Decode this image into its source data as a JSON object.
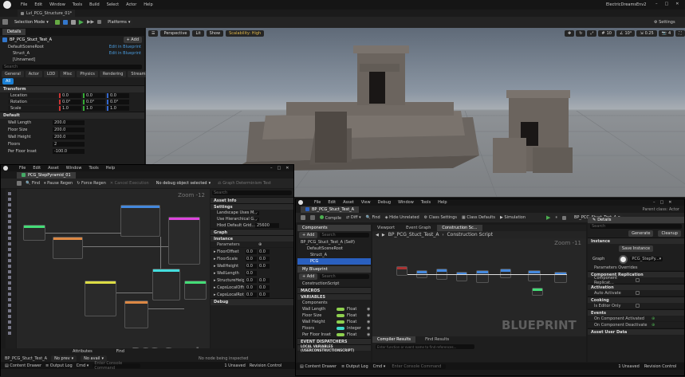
{
  "main": {
    "menu": [
      "File",
      "Edit",
      "Window",
      "Tools",
      "Build",
      "Select",
      "Actor",
      "Help"
    ],
    "window_title": "ElectricDreamsEnv2",
    "level_tab": "Lvl_PCG_Structure_01*",
    "selection_mode": "Selection Mode",
    "platforms": "Platforms",
    "settings": "Settings"
  },
  "details": {
    "tab": "Details",
    "actor_name": "BP_PCG_Stuct_Test_A",
    "add": "+ Add",
    "components": [
      {
        "name": "DefaultSceneRoot",
        "link": "Edit in Blueprint"
      },
      {
        "name": "Struct_A",
        "link": "Edit in Blueprint"
      },
      {
        "name": "[Unnamed]",
        "link": ""
      }
    ],
    "search_placeholder": "Search",
    "filter_tabs": [
      "General",
      "Actor",
      "LOD",
      "Misc",
      "Physics",
      "Rendering",
      "Streaming"
    ],
    "filter_all": "All",
    "transform_header": "Transform",
    "transform": [
      {
        "label": "Location",
        "x": "0.0",
        "y": "0.0",
        "z": "0.0"
      },
      {
        "label": "Rotation",
        "x": "0.0°",
        "y": "0.0°",
        "z": "0.0°"
      },
      {
        "label": "Scale",
        "x": "1.0",
        "y": "1.0",
        "z": "1.0"
      }
    ],
    "default_header": "Default",
    "default_props": [
      {
        "label": "Wall Length",
        "value": "200.0"
      },
      {
        "label": "Floor Size",
        "value": "200.0"
      },
      {
        "label": "Wall Height",
        "value": "200.0"
      },
      {
        "label": "Floors",
        "value": "2"
      },
      {
        "label": "Per Floor Inset",
        "value": "-100.0"
      }
    ]
  },
  "viewport": {
    "perspective": "Perspective",
    "lit": "Lit",
    "show": "Show",
    "scalability": "Scalability: High",
    "grid_value": "10",
    "rot_value": "10°",
    "scale_value": "0.25",
    "cam_value": "4"
  },
  "pcg": {
    "menu": [
      "File",
      "Edit",
      "Asset",
      "Window",
      "Tools",
      "Help"
    ],
    "tab": "PCG_StepPyramid_01",
    "toolbar": {
      "find": "Find",
      "pause": "Pause Regen",
      "force": "Force Regen",
      "cancel": "Cancel Execution",
      "debug": "No debug object selected",
      "determinism": "Graph Determinism Test"
    },
    "zoom": "Zoom -12",
    "watermark": "PCG Graph",
    "search_placeholder": "Search",
    "details_sections": [
      {
        "title": "Asset Info",
        "rows": []
      },
      {
        "title": "Settings",
        "rows": [
          {
            "k": "Landscape Uses M...",
            "v": "check"
          },
          {
            "k": "Use Hierarchical G...",
            "v": "check"
          },
          {
            "k": "Hlod Default Grid...",
            "v": "25600"
          }
        ]
      },
      {
        "title": "Graph",
        "rows": []
      },
      {
        "title": "Instance",
        "rows": []
      }
    ],
    "parameters_label": "Parameters",
    "params": [
      {
        "name": "FloorOffset",
        "x": "0.0",
        "y": "0.0"
      },
      {
        "name": "FloorScale",
        "x": "0.0",
        "y": "0.0"
      },
      {
        "name": "WallHeight",
        "x": "0.0",
        "y": "0.0"
      },
      {
        "name": "WallLength",
        "x": "0.0",
        "y": ""
      },
      {
        "name": "StructureHeight",
        "x": "0.0",
        "y": "0.0"
      },
      {
        "name": "CapsLocalOffset",
        "x": "0.0",
        "y": "0.0"
      },
      {
        "name": "CapsLocalRotati...",
        "x": "0.0",
        "y": "0.0"
      }
    ],
    "debug_section": "Debug",
    "bottom_tabs": [
      "Attributes",
      "Find"
    ],
    "bottom_node": "BP_PCG_Stuct_Test_A",
    "no_prev": "No prev",
    "no_avail": "No avail",
    "no_node": "No node being inspected",
    "cmd": "Cmd",
    "cmd_placeholder": "Enter Console Command",
    "content_drawer": "Content Drawer",
    "output_log": "Output Log",
    "unsaved": "1 Unsaved",
    "revision": "Revision Control"
  },
  "bp": {
    "menu": [
      "File",
      "Edit",
      "Asset",
      "View",
      "Debug",
      "Window",
      "Tools",
      "Help"
    ],
    "tab": "BP_PCG_Stuct_Test_A",
    "parent_class": "Parent class: Actor",
    "toolbar": {
      "compile": "Compile",
      "diff": "Diff",
      "find": "Find",
      "hide": "Hide Unrelated",
      "class_settings": "Class Settings",
      "class_defaults": "Class Defaults",
      "simulation": "Simulation"
    },
    "debug_select": "BP_PCG_Stuct_Test_A",
    "components_tab": "Components",
    "add": "+ Add",
    "search_placeholder": "Search",
    "component_tree": [
      "BP_PCG_Stuct_Test_A (Self)",
      "DefaultSceneRoot",
      "Struct_A",
      "PCG"
    ],
    "my_blueprint": "My Blueprint",
    "construction_script": "ConstructionScript",
    "macros": "MACROS",
    "variables": "VARIABLES",
    "components_cat": "Components",
    "vars": [
      {
        "name": "Wall Length",
        "type": "Float",
        "color": "#8fd14f"
      },
      {
        "name": "Floor Size",
        "type": "Float",
        "color": "#8fd14f"
      },
      {
        "name": "Wall Height",
        "type": "Float",
        "color": "#8fd14f"
      },
      {
        "name": "Floors",
        "type": "Integer",
        "color": "#3fd9c8"
      },
      {
        "name": "Per Floor Inset",
        "type": "Float",
        "color": "#8fd14f"
      }
    ],
    "event_dispatchers": "EVENT DISPATCHERS",
    "local_vars": "LOCAL VARIABLES (USERCONSTRUCTIONSCRIPT)",
    "graph_tabs": [
      "Viewport",
      "Event Graph",
      "Construction Sc..."
    ],
    "breadcrumb_a": "BP_PCG_Stuct_Test_A",
    "breadcrumb_b": "Construction Script",
    "zoom": "Zoom -11",
    "watermark": "BLUEPRINT",
    "compiler_tab": "Compiler Results",
    "find_tab": "Find Results",
    "find_placeholder": "Enter function or event name to find references...",
    "details_tab": "Details",
    "details_search": "Search",
    "generate": "Generate",
    "cleanup": "Cleanup",
    "instance": "Instance",
    "save_instance": "Save Instance",
    "graph_label": "Graph",
    "graph_value": "PCG_StepPy...",
    "param_overrides": "Parameters Overrides",
    "component_replication": "Component Replication",
    "component_replicates": "Component Replicat...",
    "activation": "Activation",
    "auto_activate": "Auto Activate",
    "cooking": "Cooking",
    "is_editor_only": "Is Editor Only",
    "events": "Events",
    "on_activated": "On Component Activated",
    "on_deactivated": "On Component Deactivate",
    "asset_user_data": "Asset User Data",
    "content_drawer": "Content Drawer",
    "output_log": "Output Log",
    "cmd": "Cmd",
    "cmd_placeholder": "Enter Console Command",
    "unsaved": "1 Unsaved",
    "revision": "Revision Control"
  },
  "colors": {
    "accent": "#1a7fd4",
    "play": "#4caf50",
    "float": "#8fd14f",
    "integer": "#3fd9c8",
    "component": "#2a60c0"
  }
}
